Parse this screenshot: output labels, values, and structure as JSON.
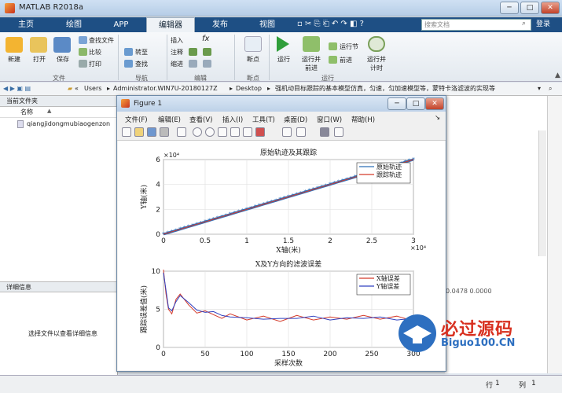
{
  "app": {
    "title": "MATLAB R2018a",
    "icon": "matlab-logo"
  },
  "window_buttons": [
    "─",
    "□",
    "✕"
  ],
  "tabs": [
    "主页",
    "绘图",
    "APP",
    "编辑器",
    "发布",
    "视图"
  ],
  "active_tab": "编辑器",
  "search": {
    "placeholder": "搜索文档"
  },
  "login": "登录",
  "ribbon": {
    "file": {
      "new": "新建",
      "open": "打开",
      "save": "保存",
      "find_files": "查找文件",
      "compare": "比较",
      "print": "打印",
      "group": "文件"
    },
    "navigate": {
      "goto": "转至",
      "find": "查找",
      "group": "导航"
    },
    "edit": {
      "insert": "插入",
      "comment": "注释",
      "indent": "缩进",
      "fx": "fx",
      "group": "编辑"
    },
    "breakpoints": {
      "label": "断点",
      "group": "断点"
    },
    "run": {
      "run": "运行",
      "run_advance": "运行并\n前进",
      "run_section": "运行节",
      "advance": "前进",
      "run_time": "运行并\n计时",
      "group": "运行"
    }
  },
  "address": {
    "segments": [
      "«",
      "Users",
      "Administrator.WIN7U-20180127Z",
      "Desktop",
      "强机动目标跟踪的基本模型仿真，匀速，匀加速模型等，蒙特卡洛滤波的实现等"
    ],
    "right_text": "，匀速，匀加速模型等，蒙特..."
  },
  "current_folder": {
    "title": "当前文件夹",
    "col_name": "名称",
    "sort": "▲",
    "file": "qiangjidongmubiaogenzon"
  },
  "details": {
    "title": "详细信息",
    "empty": "选择文件以查看详细信息"
  },
  "right_values": "0.0478 0.0000",
  "status": {
    "row_label": "行",
    "row": "1",
    "col_label": "列",
    "col": "1"
  },
  "figure": {
    "title": "Figure 1",
    "menu": [
      "文件(F)",
      "编辑(E)",
      "查看(V)",
      "插入(I)",
      "工具(T)",
      "桌面(D)",
      "窗口(W)",
      "帮助(H)"
    ],
    "toolbar_icons": [
      "new-icon",
      "open-icon",
      "save-icon",
      "print-icon",
      "pointer-icon",
      "zoom-in-icon",
      "zoom-out-icon",
      "pan-icon",
      "rotate-icon",
      "datacursor-icon",
      "brush-icon",
      "colorbar-icon",
      "legend-icon",
      "hide-tools-icon",
      "dock-icon"
    ]
  },
  "chart_data": [
    {
      "type": "line",
      "title": "原始轨迹及其跟踪",
      "xlabel": "X轴(米)",
      "ylabel": "Y轴(米)",
      "xlim": [
        0,
        30000
      ],
      "ylim": [
        0,
        60000
      ],
      "x_ticks": [
        "0",
        "0.5",
        "1",
        "1.5",
        "2",
        "2.5",
        "3"
      ],
      "x_mult": "×10⁴",
      "y_ticks": [
        "0",
        "2",
        "4",
        "6"
      ],
      "y_mult": "×10⁴",
      "grid": true,
      "legend": "top-right",
      "series": [
        {
          "name": "原始轨迹",
          "color": "#2f6fb8",
          "marker": "*",
          "x": [
            0,
            30000
          ],
          "y": [
            0,
            60000
          ]
        },
        {
          "name": "跟踪轨迹",
          "color": "#d43a2a",
          "x": [
            0,
            30000
          ],
          "y": [
            0,
            60000
          ]
        }
      ]
    },
    {
      "type": "line",
      "title": "X及Y方向的滤波误差",
      "xlabel": "采样次数",
      "ylabel": "跟踪误差值(米)",
      "xlim": [
        0,
        300
      ],
      "ylim": [
        0,
        10
      ],
      "x_ticks": [
        "0",
        "50",
        "100",
        "150",
        "200",
        "250",
        "300"
      ],
      "y_ticks": [
        "0",
        "5",
        "10"
      ],
      "grid": true,
      "legend": "top-right",
      "series": [
        {
          "name": "X轴误差",
          "color": "#d43a2a",
          "x": [
            0,
            3,
            6,
            10,
            15,
            20,
            30,
            40,
            50,
            60,
            70,
            80,
            100,
            120,
            140,
            160,
            180,
            200,
            220,
            240,
            260,
            280,
            300
          ],
          "y": [
            10.2,
            7,
            5,
            4.4,
            6.3,
            7.0,
            5.6,
            4.5,
            4.8,
            4.3,
            3.8,
            4.4,
            3.6,
            4.1,
            3.4,
            4.2,
            3.6,
            4.0,
            3.7,
            4.2,
            3.7,
            4.1,
            3.5
          ]
        },
        {
          "name": "Y轴误差",
          "color": "#3040c0",
          "x": [
            0,
            3,
            6,
            10,
            15,
            20,
            30,
            40,
            50,
            60,
            70,
            80,
            100,
            120,
            140,
            160,
            180,
            200,
            220,
            240,
            260,
            280,
            300
          ],
          "y": [
            9.8,
            7.5,
            5.2,
            4.8,
            6.0,
            6.8,
            5.9,
            4.9,
            4.6,
            4.7,
            4.2,
            4.0,
            3.9,
            3.7,
            3.8,
            3.8,
            4.1,
            3.6,
            3.9,
            3.8,
            4.0,
            3.6,
            3.8
          ]
        }
      ]
    }
  ],
  "watermark": {
    "title": "必过源码",
    "url": "Biguo100.CN"
  }
}
